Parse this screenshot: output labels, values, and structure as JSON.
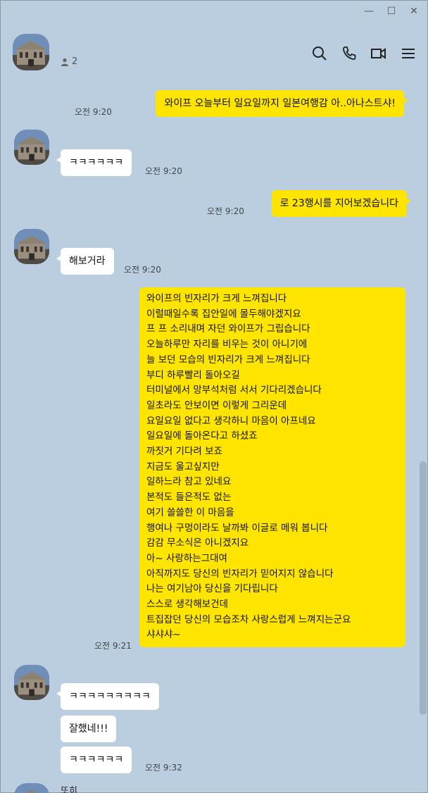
{
  "window": {
    "controls": [
      "—",
      "☐",
      "✕"
    ]
  },
  "header": {
    "member_count": "2",
    "icons": [
      "search-icon",
      "phone-icon",
      "video-icon",
      "menu-icon"
    ]
  },
  "messages": [
    {
      "side": "me",
      "text": "와이프 오늘부터 일요일까지 일본여행감 아..아나스트샤!",
      "time": "오전 9:20"
    },
    {
      "side": "other",
      "text": "ㅋㅋㅋㅋㅋㅋ",
      "time": "오전 9:20"
    },
    {
      "side": "me",
      "text": "로 23행시를 지어보겠습니다",
      "time": "오전 9:20"
    },
    {
      "side": "other",
      "text": "해보거라",
      "time": "오전 9:20"
    },
    {
      "side": "me",
      "text": "와이프의 빈자리가 크게 느껴집니다\n이럴때일수록 집안일에 몰두해야겠지요\n프 프 소리내며 자던 와이프가 그립습니다\n오늘하루만 자리를 비우는 것이 아니기에\n늘 보던 모습의 빈자리가 크게 느껴집니다\n부디 하루빨리 돌아오길\n터미널에서 망부석처럼 서서 기다리겠습니다\n일초라도 안보이면 이렇게 그리운데\n요일요일 없다고 생각하니 마음이 아프네요\n일요일에 돌아온다고 하셨죠\n까짓거 기다려 보죠\n지금도 울고싶지만\n일하느라 참고 있네요\n본적도 들은적도 없는\n여기 쓸쓸한 이 마음을\n행여나 구멍이라도 날까봐 이글로 메워 봅니다\n감감 무소식은 아니겠지요\n아~ 사랑하는그대여\n아직까지도 당신의 빈자리가 믿어지지 않습니다\n나는 여기남아 당신을 기다립니다\n스스로 생각해보건데\n트집잡던 당신의 모습조차 사랑스럽게 느껴지는군요\n샤샤샤~",
      "time": "오전 9:21"
    },
    {
      "side": "other",
      "text": "ㅋㅋㅋㅋㅋㅋㅋㅋㅋ",
      "time": ""
    },
    {
      "side": "other",
      "text": "잘했네!!!",
      "time": ""
    },
    {
      "side": "other",
      "text": "ㅋㅋㅋㅋㅋㅋ",
      "time": "오전 9:32"
    },
    {
      "side": "other",
      "sender": "또히",
      "text": "",
      "time": ""
    }
  ]
}
